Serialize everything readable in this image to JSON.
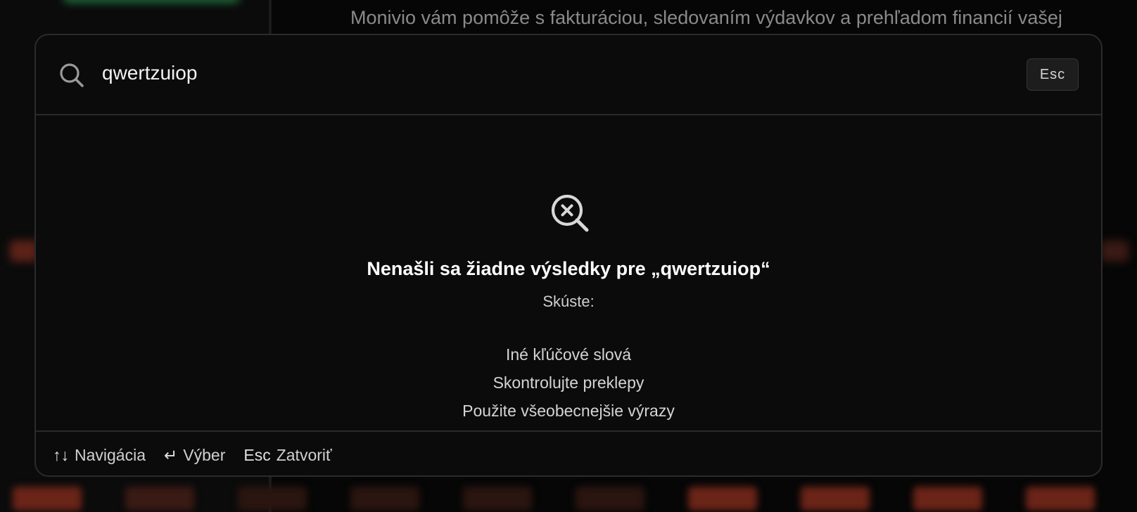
{
  "background": {
    "description_text": "Monivio vám pomôže s fakturáciou, sledovaním výdavkov a prehľadom financií vašej"
  },
  "search": {
    "value": "qwertzuiop",
    "esc_label": "Esc"
  },
  "empty_state": {
    "title": "Nenašli sa žiadne výsledky pre „qwertzuiop“",
    "try_label": "Skúste:",
    "suggestions": [
      "Iné kľúčové slová",
      "Skontrolujte preklepy",
      "Použite všeobecnejšie výrazy"
    ]
  },
  "footer": {
    "navigate": {
      "key": "↑↓",
      "label": "Navigácia"
    },
    "select": {
      "key": "↵",
      "label": "Výber"
    },
    "close": {
      "key": "Esc",
      "label": "Zatvoriť"
    }
  },
  "colors": {
    "modal_bg": "#0b0b0b",
    "border": "#2a2a2a",
    "text_primary": "#ffffff",
    "text_secondary": "#d0d0d0",
    "accent_background": "#6a2418"
  }
}
